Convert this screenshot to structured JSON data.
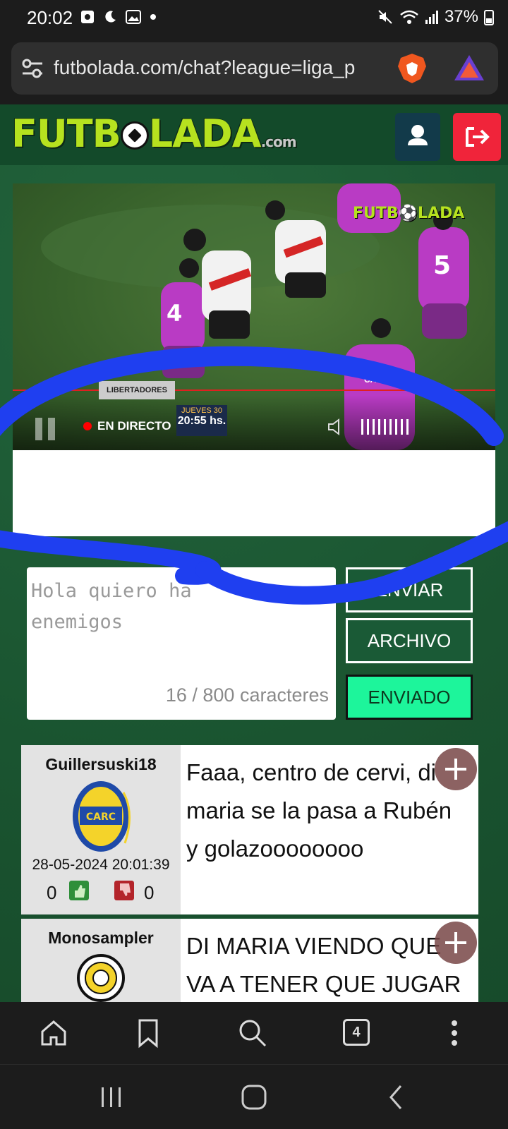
{
  "status_bar": {
    "time": "20:02",
    "battery": "37%"
  },
  "browser": {
    "url": "futbolada.com/chat?league=liga_p",
    "tab_count": "4"
  },
  "site": {
    "logo_text_left": "FUTB",
    "logo_text_right": "LADA",
    "logo_suffix": ".com"
  },
  "video": {
    "watermark": "FUTB⚽LADA",
    "live_label": "EN DIRECTO",
    "competition": "LIBERTADORES",
    "match_day": "JUEVES 30",
    "match_time": "20:55 hs.",
    "team_label": "TACHIRA"
  },
  "compose": {
    "placeholder": "Hola quiero ha\nenemigos",
    "char_count": "16 / 800 caracteres",
    "send_label": "ENVIAR",
    "file_label": "ARCHIVO",
    "sent_label": "ENVIADO"
  },
  "messages": [
    {
      "user": "Guillersuski18",
      "date": "28-05-2024 20:01:39",
      "likes": "0",
      "dislikes": "0",
      "text": "Faaa, centro de cervi, di maria se la pasa a Rubén y golazoooooooo"
    },
    {
      "user": "Monosampler",
      "text": "DI MARIA VIENDO QUE VA A TENER QUE JUGAR"
    }
  ],
  "colors": {
    "page_bg": "#1d5a35",
    "accent_green": "#1df59b",
    "logo_green": "#b6e21f",
    "logout_red": "#f0243a",
    "scribble_blue": "#1f3ff0"
  }
}
